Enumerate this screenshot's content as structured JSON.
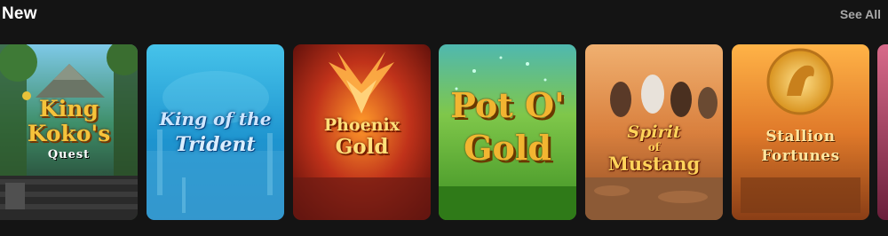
{
  "section": {
    "title": "New",
    "see_all_label": "See All"
  },
  "games": [
    {
      "name_line1": "King",
      "name_line2": "Koko's",
      "name_line3": "Quest"
    },
    {
      "name_line1": "King of the",
      "name_line2": "Trident"
    },
    {
      "name_line1": "Phoenix",
      "name_line2": "Gold"
    },
    {
      "name_line1": "Pot O'",
      "name_line2": "Gold"
    },
    {
      "name_line1": "Spirit",
      "name_line2": "of",
      "name_line3": "Mustang"
    },
    {
      "name_line1": "Stallion",
      "name_line2": "Fortunes"
    }
  ],
  "colors": {
    "background": "#141414",
    "see_all": "#a8a8a8",
    "title": "#ffffff"
  }
}
